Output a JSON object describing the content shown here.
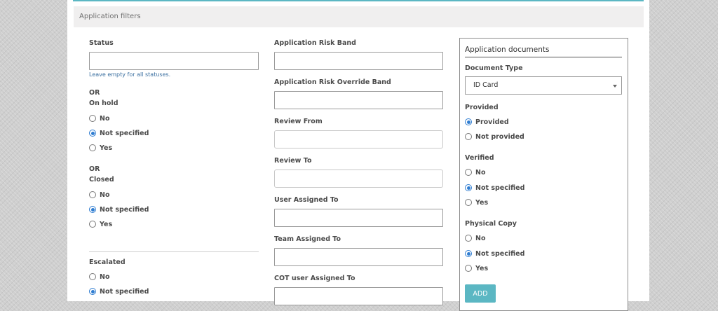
{
  "panel": {
    "title": "Application filters"
  },
  "left": {
    "status_label": "Status",
    "status_value": "",
    "status_help": "Leave empty for all statuses.",
    "or_1": "OR",
    "on_hold": {
      "label": "On hold",
      "options": [
        {
          "label": "No",
          "selected": false
        },
        {
          "label": "Not specified",
          "selected": true
        },
        {
          "label": "Yes",
          "selected": false
        }
      ]
    },
    "or_2": "OR",
    "closed": {
      "label": "Closed",
      "options": [
        {
          "label": "No",
          "selected": false
        },
        {
          "label": "Not specified",
          "selected": true
        },
        {
          "label": "Yes",
          "selected": false
        }
      ]
    },
    "escalated": {
      "label": "Escalated",
      "options": [
        {
          "label": "No",
          "selected": false
        },
        {
          "label": "Not specified",
          "selected": true
        }
      ]
    }
  },
  "middle": {
    "risk_band_label": "Application Risk Band",
    "risk_band_value": "",
    "risk_override_label": "Application Risk Override Band",
    "risk_override_value": "",
    "review_from_label": "Review From",
    "review_from_value": "",
    "review_to_label": "Review To",
    "review_to_value": "",
    "user_assigned_label": "User Assigned To",
    "user_assigned_value": "",
    "team_assigned_label": "Team Assigned To",
    "team_assigned_value": "",
    "cot_user_label": "COT user Assigned To",
    "cot_user_value": ""
  },
  "documents": {
    "title": "Application documents",
    "document_type_label": "Document Type",
    "document_type_value": "ID Card",
    "provided": {
      "label": "Provided",
      "options": [
        {
          "label": "Provided",
          "selected": true
        },
        {
          "label": "Not provided",
          "selected": false
        }
      ]
    },
    "verified": {
      "label": "Verified",
      "options": [
        {
          "label": "No",
          "selected": false
        },
        {
          "label": "Not specified",
          "selected": true
        },
        {
          "label": "Yes",
          "selected": false
        }
      ]
    },
    "physical_copy": {
      "label": "Physical Copy",
      "options": [
        {
          "label": "No",
          "selected": false
        },
        {
          "label": "Not specified",
          "selected": true
        },
        {
          "label": "Yes",
          "selected": false
        }
      ]
    },
    "add_label": "ADD"
  },
  "colors": {
    "accent": "#5bb7c3",
    "radio_selected": "#2f7dd1",
    "header_bg": "#f0efef"
  }
}
